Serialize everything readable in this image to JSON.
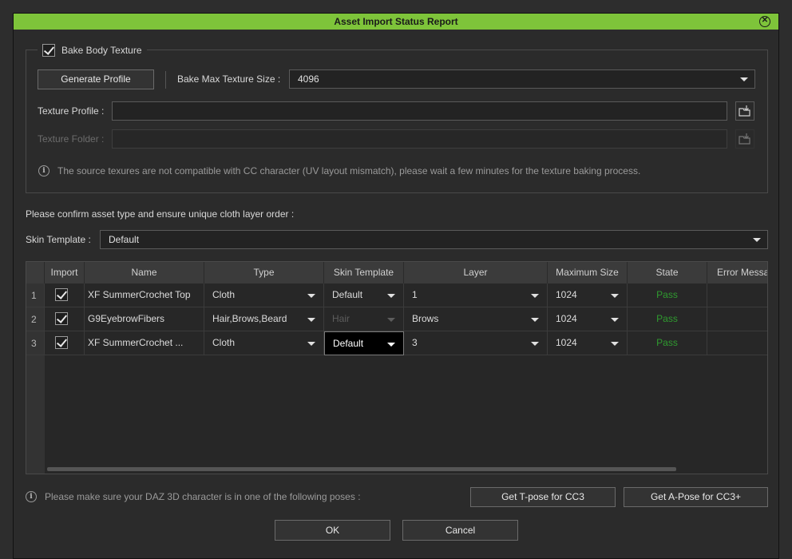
{
  "title": "Asset Import Status Report",
  "bake": {
    "checkbox_label": "Bake Body Texture",
    "checked": true,
    "generate_profile": "Generate Profile",
    "max_size_label": "Bake Max Texture Size :",
    "max_size_value": "4096",
    "texture_profile_label": "Texture Profile :",
    "texture_folder_label": "Texture Folder :",
    "info": "The source texures are not compatible with CC character (UV layout mismatch), please wait a few minutes for the texture baking process."
  },
  "confirm_text": "Please confirm asset type and ensure unique cloth layer order :",
  "skin_template": {
    "label": "Skin Template :",
    "value": "Default"
  },
  "table": {
    "headers": [
      "",
      "Import",
      "Name",
      "Type",
      "Skin Template",
      "Layer",
      "Maximum Size",
      "State",
      "Error Message"
    ],
    "rows": [
      {
        "num": "1",
        "import": true,
        "name": "XF SummerCrochet Top",
        "type": "Cloth",
        "skin": "Default",
        "layer": "1",
        "max": "1024",
        "state": "Pass"
      },
      {
        "num": "2",
        "import": true,
        "name": "G9EyebrowFibers",
        "type": "Hair,Brows,Beard",
        "skin": "Hair",
        "layer": "Brows",
        "max": "1024",
        "state": "Pass"
      },
      {
        "num": "3",
        "import": true,
        "name": "XF SummerCrochet ...",
        "type": "Cloth",
        "skin": "Default",
        "layer": "3",
        "max": "1024",
        "state": "Pass"
      }
    ]
  },
  "pose_info": "Please make sure your DAZ 3D character is in one of the following poses :",
  "buttons": {
    "tpose": "Get T-pose for CC3",
    "apose": "Get A-Pose for CC3+",
    "ok": "OK",
    "cancel": "Cancel"
  },
  "icons": {
    "close": "close-icon",
    "info": "info-icon",
    "folder": "folder-open-icon",
    "check": "checkmark-icon",
    "dropdown": "chevron-down-icon"
  },
  "colors": {
    "titlebar": "#7ec43a",
    "pass": "#2f9b2f",
    "background": "#2b2b2b"
  }
}
